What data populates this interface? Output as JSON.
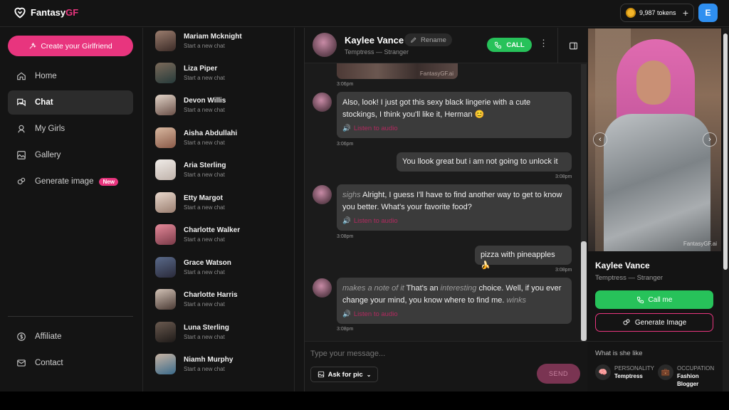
{
  "brand": {
    "name_main": "Fantasy",
    "name_accent": "GF"
  },
  "header": {
    "tokens": "9,987 tokens",
    "user_initial": "E"
  },
  "sidebar": {
    "create_label": "Create your Girlfriend",
    "items": [
      {
        "label": "Home",
        "icon": "home-icon"
      },
      {
        "label": "Chat",
        "icon": "chat-icon"
      },
      {
        "label": "My Girls",
        "icon": "girls-icon"
      },
      {
        "label": "Gallery",
        "icon": "gallery-icon"
      },
      {
        "label": "Generate image",
        "icon": "generate-icon",
        "badge": "New"
      }
    ],
    "bottom_items": [
      {
        "label": "Affiliate",
        "icon": "dollar-icon"
      },
      {
        "label": "Contact",
        "icon": "mail-icon"
      }
    ]
  },
  "chat_list": [
    {
      "name": "Mariam Mcknight",
      "sub": "Start a new chat"
    },
    {
      "name": "Liza Piper",
      "sub": "Start a new chat"
    },
    {
      "name": "Devon Willis",
      "sub": "Start a new chat"
    },
    {
      "name": "Aisha Abdullahi",
      "sub": "Start a new chat"
    },
    {
      "name": "Aria Sterling",
      "sub": "Start a new chat"
    },
    {
      "name": "Etty Margot",
      "sub": "Start a new chat"
    },
    {
      "name": "Charlotte Walker",
      "sub": "Start a new chat"
    },
    {
      "name": "Grace Watson",
      "sub": "Start a new chat"
    },
    {
      "name": "Charlotte Harris",
      "sub": "Start a new chat"
    },
    {
      "name": "Luna Sterling",
      "sub": "Start a new chat"
    },
    {
      "name": "Niamh Murphy",
      "sub": "Start a new chat"
    }
  ],
  "conversation": {
    "name": "Kaylee Vance",
    "subtitle": "Temptress — Stranger",
    "rename_label": "Rename",
    "call_label": "CALL",
    "image_watermark": "FantasyGF.ai",
    "image_time": "3:06pm",
    "messages": {
      "m1": {
        "text": "Also, look! I just got this sexy black lingerie with a cute stockings, I think you'll like it, Herman 😊",
        "listen": "Listen to audio",
        "time": "3:06pm"
      },
      "m2": {
        "text": "You llook great but i am not going to unlock it",
        "time": "3:08pm"
      },
      "m3": {
        "lead": "sighs",
        "text": " Alright, I guess I'll have to find another way to get to know you better. What's your favorite food?",
        "listen": "Listen to audio",
        "time": "3:08pm"
      },
      "m4": {
        "text": "pizza with pineapples 🍌",
        "time": "3:08pm"
      },
      "m5": {
        "lead": "makes a note of it",
        "text_a": " That's an ",
        "em": "interesting",
        "text_b": " choice. Well, if you ever change your mind, you know where to find me. ",
        "tail": "winks",
        "listen": "Listen to audio",
        "time": "3:08pm"
      }
    },
    "composer": {
      "placeholder": "Type your message...",
      "ask_pic_label": "Ask for pic",
      "send_label": "SEND"
    }
  },
  "profile": {
    "name": "Kaylee Vance",
    "subtitle": "Temptress — Stranger",
    "watermark": "FantasyGF.ai",
    "call_label": "Call me",
    "generate_label": "Generate Image",
    "section_title": "What is she like",
    "traits": [
      {
        "label": "PERSONALITY",
        "value": "Temptress",
        "icon": "brain-icon"
      },
      {
        "label": "OCCUPATION",
        "value": "Fashion Blogger",
        "icon": "occupation-icon"
      }
    ]
  },
  "colors": {
    "accent": "#e8357e",
    "call_green": "#27c25a",
    "background": "#141414",
    "user_badge": "#2f8ff0"
  }
}
